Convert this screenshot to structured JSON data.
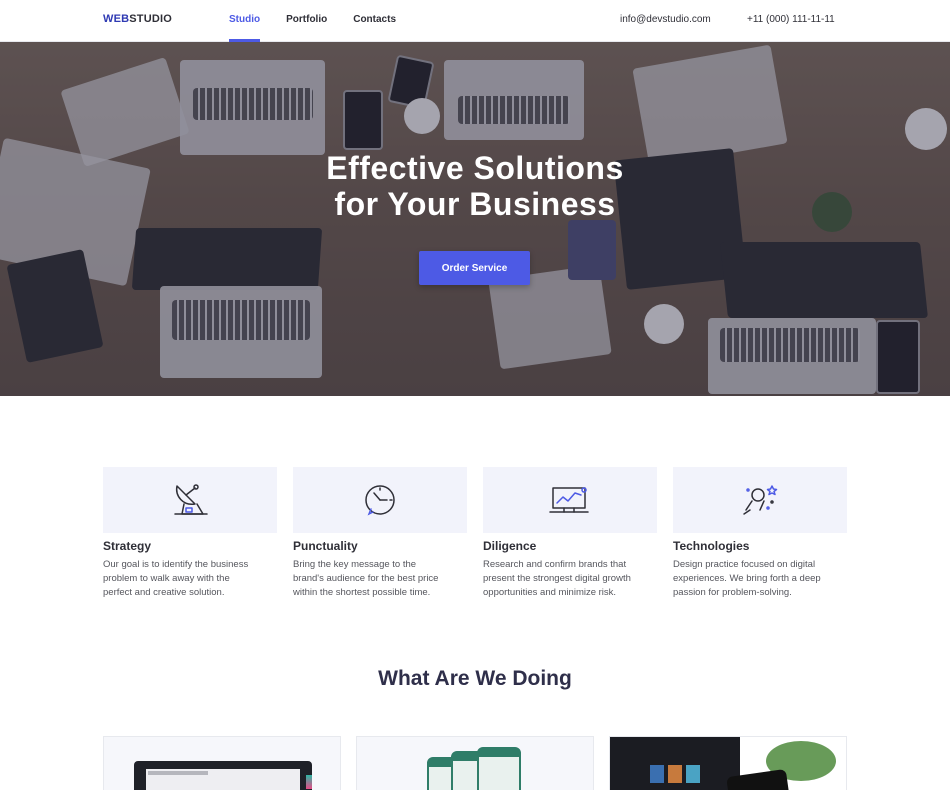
{
  "header": {
    "logo_accent": "WEB",
    "logo_rest": "STUDIO",
    "nav": [
      "Studio",
      "Portfolio",
      "Contacts"
    ],
    "active_nav": "Studio",
    "email": "info@devstudio.com",
    "phone": "+11 (000) 111-11-11"
  },
  "hero": {
    "title_line1": "Effective Solutions",
    "title_line2": "for Your Business",
    "button_label": "Order Service"
  },
  "features": [
    {
      "icon": "satellite-dish-icon",
      "title": "Strategy",
      "text_lines": [
        "Our goal is to identify the business",
        "problem to walk away with the",
        "perfect and creative solution."
      ]
    },
    {
      "icon": "clock-icon",
      "title": "Punctuality",
      "text_lines": [
        "Bring the key message to the",
        "brand's audience for the best price",
        "within the shortest possible time."
      ]
    },
    {
      "icon": "analytics-monitor-icon",
      "title": "Diligence",
      "text_lines": [
        "Research and confirm brands that",
        "present the strongest digital growth",
        "opportunities and minimize risk."
      ]
    },
    {
      "icon": "astronaut-rocket-icon",
      "title": "Technologies",
      "text_lines": [
        "Design practice focused on digital",
        "experiences. We bring forth a deep",
        "passion for problem-solving."
      ]
    }
  ],
  "section": {
    "title": "What Are We Doing"
  },
  "colors": {
    "accent": "#4d5ae5",
    "logo_accent": "#2f3ab3",
    "feature_bg": "#f2f3fb",
    "text": "#2f2f37"
  }
}
